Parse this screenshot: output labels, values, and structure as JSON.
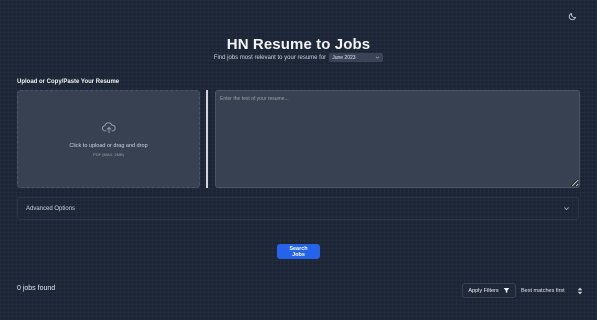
{
  "header": {
    "title": "HN Resume to Jobs",
    "subtitle": "Find jobs most relevant to your resume for",
    "month_selected": "June 2023"
  },
  "upload": {
    "section_label": "Upload or Copy/Paste Your Resume",
    "prompt": "Click to upload or drag and drop",
    "hint": "PDF (MAX. 2MB)"
  },
  "resume_input": {
    "placeholder": "Enter the text of your resume...",
    "value": ""
  },
  "advanced": {
    "label": "Advanced Options"
  },
  "actions": {
    "search_label": "Search Jobs"
  },
  "results": {
    "count_text": "0 jobs found",
    "filters_label": "Apply Filters",
    "sort_selected": "Best matches first"
  },
  "icons": {
    "theme": "moon-icon",
    "upload": "cloud-upload-icon",
    "month_dropdown": "chevron-down-icon",
    "advanced_toggle": "chevron-down-icon",
    "filter": "filter-icon",
    "sort": "sort-arrows-icon"
  },
  "colors": {
    "background": "#1c2535",
    "panel": "#374151",
    "accent": "#2563eb"
  }
}
